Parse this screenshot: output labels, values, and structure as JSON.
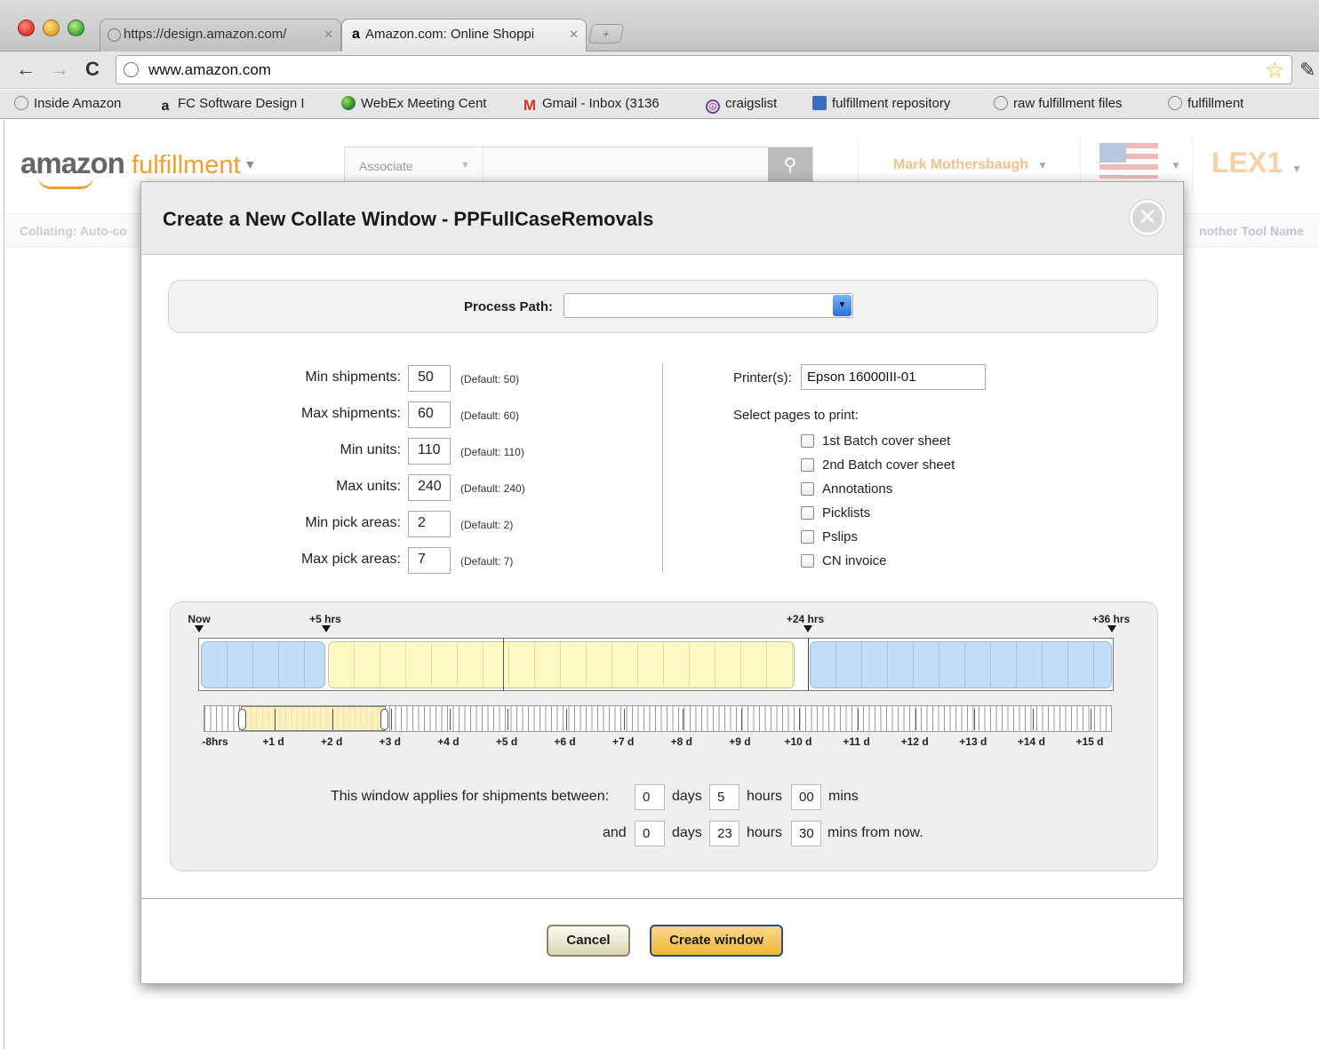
{
  "browser": {
    "tabs": [
      {
        "title": "https://design.amazon.com/",
        "close": "✕",
        "active": false
      },
      {
        "title": "Amazon.com: Online Shoppi",
        "close": "✕",
        "active": true
      }
    ],
    "new_tab_glyph": "+",
    "url": "www.amazon.com",
    "nav": {
      "back": "←",
      "forward": "→",
      "reload": "C",
      "star": "☆",
      "wrench": "🔧"
    },
    "bookmarks": [
      {
        "label": "Inside Amazon",
        "icon": "globe-icon"
      },
      {
        "label": "FC Software Design I",
        "icon": "amazon-icon"
      },
      {
        "label": "WebEx Meeting Cent",
        "icon": "webex-icon"
      },
      {
        "label": "Gmail - Inbox (3136",
        "icon": "gmail-icon"
      },
      {
        "label": "craigslist",
        "icon": "peace-icon"
      },
      {
        "label": "fulfillment repository",
        "icon": "repository-icon"
      },
      {
        "label": "raw fulfillment files",
        "icon": "globe-icon"
      },
      {
        "label": "fulfillment",
        "icon": "globe-icon"
      }
    ]
  },
  "page": {
    "logo_amazon": "amazon",
    "logo_fulfillment": "fulfillment",
    "search_scope": "Associate",
    "search_icon": "🔍",
    "user_name": "Mark Mothersbaugh",
    "site": "LEX1",
    "subbar_left": "Collating: Auto-co",
    "subbar_right": "nother Tool Name"
  },
  "modal": {
    "title": "Create a New Collate Window - PPFullCaseRemovals",
    "close_glyph": "✕",
    "process_path_label": "Process Path:",
    "process_path_value": "",
    "fields": [
      {
        "label": "Min shipments:",
        "value": "50",
        "default": "(Default: 50)"
      },
      {
        "label": "Max shipments:",
        "value": "60",
        "default": "(Default: 60)"
      },
      {
        "label": "Min units:",
        "value": "110",
        "default": "(Default: 110)"
      },
      {
        "label": "Max units:",
        "value": "240",
        "default": "(Default: 240)"
      },
      {
        "label": "Min pick areas:",
        "value": "2",
        "default": "(Default: 2)"
      },
      {
        "label": "Max pick areas:",
        "value": "7",
        "default": "(Default: 7)"
      }
    ],
    "printer_label": "Printer(s):",
    "printer_value": "Epson 16000III-01",
    "pages_label": "Select pages to print:",
    "pages": [
      {
        "label": "1st Batch cover sheet",
        "checked": false
      },
      {
        "label": "2nd Batch cover sheet",
        "checked": false
      },
      {
        "label": "Annotations",
        "checked": false
      },
      {
        "label": "Picklists",
        "checked": false
      },
      {
        "label": "Pslips",
        "checked": false
      },
      {
        "label": "CN invoice",
        "checked": false
      }
    ],
    "timeline": {
      "markers": [
        "Now",
        "+5 hrs",
        "+24 hrs",
        "+36 hrs"
      ],
      "day_labels": [
        "-8hrs",
        "+1 d",
        "+2 d",
        "+3 d",
        "+4 d",
        "+5 d",
        "+6 d",
        "+7 d",
        "+8 d",
        "+9 d",
        "+10 d",
        "+11 d",
        "+12 d",
        "+13 d",
        "+14 d",
        "+15 d"
      ]
    },
    "range": {
      "lead": "This window applies for shipments between:",
      "start_days": "0",
      "start_hours": "5",
      "start_mins": "00",
      "and": "and",
      "end_days": "0",
      "end_hours": "23",
      "end_mins": "30",
      "days": "days",
      "hours": "hours",
      "mins": "mins",
      "mins_from_now": "mins from now."
    },
    "cancel_label": "Cancel",
    "create_label": "Create window"
  }
}
